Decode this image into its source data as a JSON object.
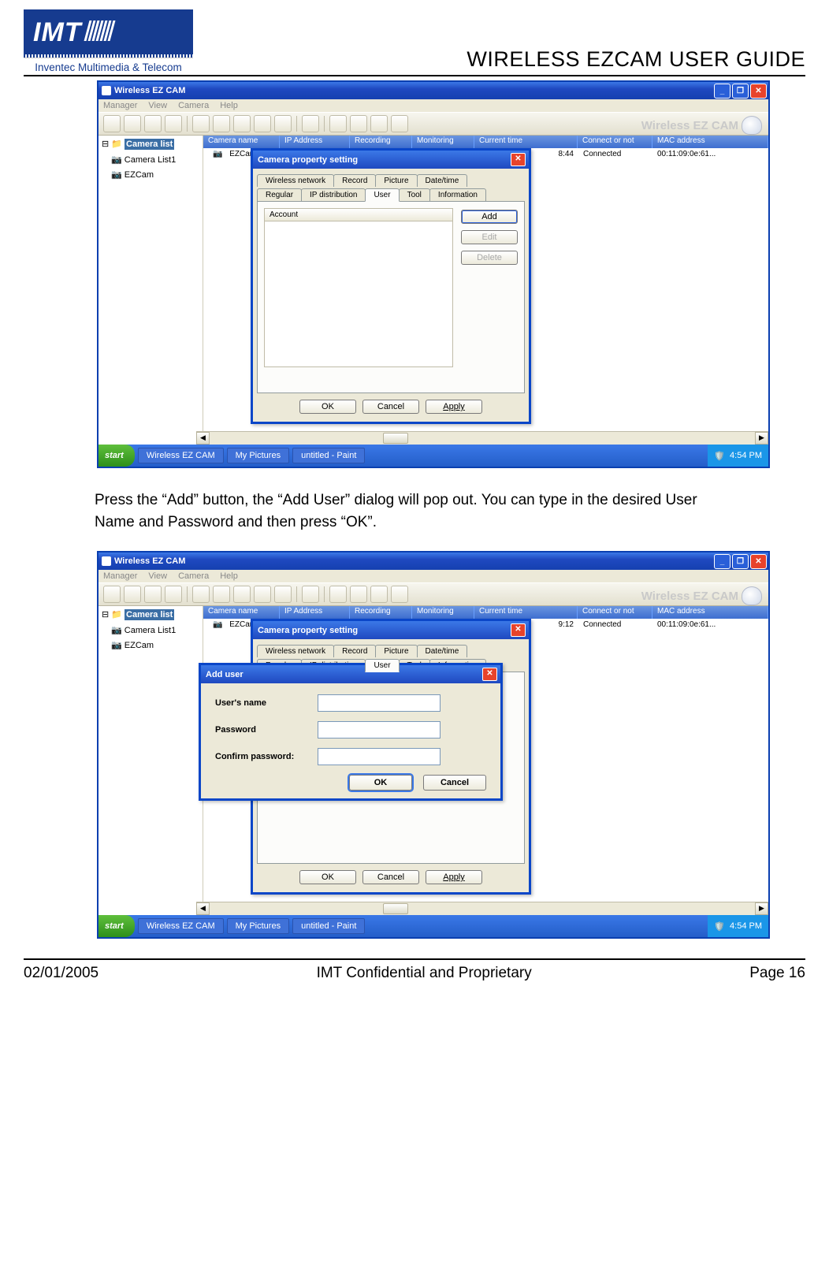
{
  "header": {
    "logo_text": "IMT",
    "logo_caption": "Inventec Multimedia & Telecom",
    "doc_title": "WIRELESS EZCAM USER GUIDE"
  },
  "body": {
    "paragraph": "Press the “Add” button, the “Add User” dialog will pop out.  You can type in the desired User Name and Password and then press “OK”."
  },
  "footer": {
    "date": "02/01/2005",
    "center": "IMT Confidential and Proprietary",
    "page": "Page 16"
  },
  "xp": {
    "window_title": "Wireless EZ CAM",
    "menus": [
      "Manager",
      "View",
      "Camera",
      "Help"
    ],
    "brand": "Wireless EZ CAM",
    "tree_root": "Camera list",
    "tree_items": [
      "Camera List1",
      "EZCam"
    ],
    "columns": [
      "Camera name",
      "IP Address",
      "Recording",
      "Monitoring",
      "Current time",
      "Connect or not",
      "MAC address"
    ],
    "row1": {
      "name": "EZCam",
      "time": "8:44",
      "connect": "Connected",
      "mac": "00:11:09:0e:61..."
    },
    "row2": {
      "name": "EZCam",
      "time": "9:12",
      "connect": "Connected",
      "mac": "00:11:09:0e:61..."
    },
    "taskbar": {
      "start": "start",
      "items": [
        "Wireless EZ CAM",
        "My Pictures",
        "untitled - Paint"
      ],
      "clock": "4:54 PM"
    }
  },
  "prop_dialog": {
    "title": "Camera property setting",
    "tabs_top": [
      "Wireless network",
      "Record",
      "Picture",
      "Date/time"
    ],
    "tabs_bottom": [
      "Regular",
      "IP distribution",
      "User",
      "Tool",
      "Information"
    ],
    "account_header": "Account",
    "btn_add": "Add",
    "btn_edit": "Edit",
    "btn_delete": "Delete",
    "btn_ok": "OK",
    "btn_cancel": "Cancel",
    "btn_apply": "Apply"
  },
  "add_user_dialog": {
    "title": "Add user",
    "lbl_username": "User's name",
    "lbl_password": "Password",
    "lbl_confirm": "Confirm password:",
    "btn_ok": "OK",
    "btn_cancel": "Cancel"
  }
}
